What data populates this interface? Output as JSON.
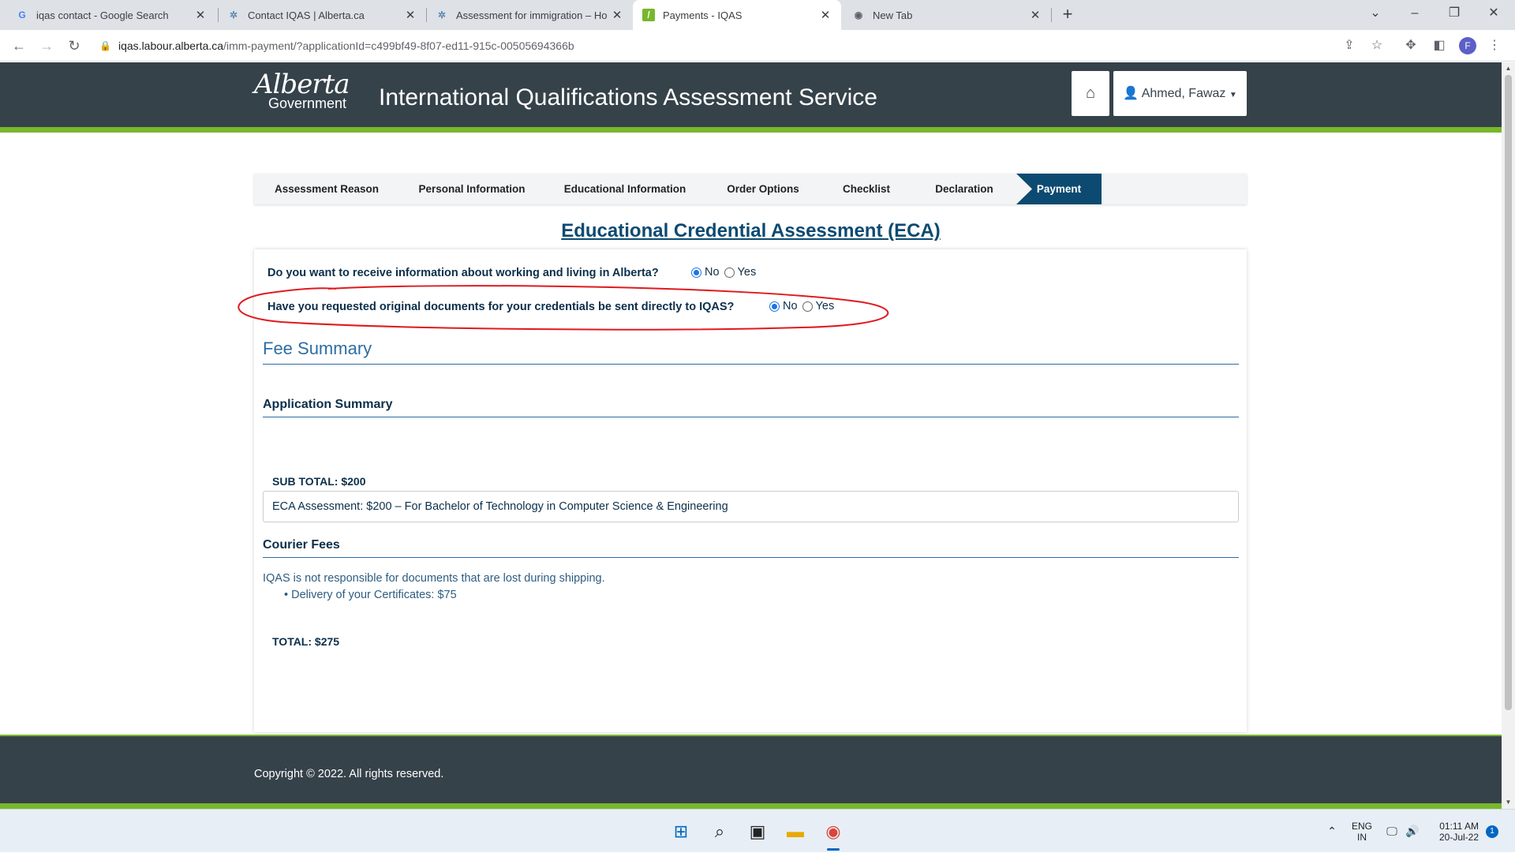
{
  "browser": {
    "tabs": [
      {
        "title": "iqas contact - Google Search",
        "icon": "google-icon"
      },
      {
        "title": "Contact IQAS | Alberta.ca",
        "icon": "alberta-icon"
      },
      {
        "title": "Assessment for immigration – Ho",
        "icon": "alberta-icon"
      },
      {
        "title": "Payments - IQAS",
        "icon": "iqas-icon"
      },
      {
        "title": "New Tab",
        "icon": "chrome-icon"
      }
    ],
    "url_host": "iqas.labour.alberta.ca",
    "url_path": "/imm-payment/?applicationId=c499bf49-8f07-ed11-915c-00505694366b",
    "profile_initial": "F"
  },
  "site": {
    "logo_script": "Alberta",
    "logo_sub": "Government",
    "title": "International Qualifications Assessment Service",
    "user_name": "Ahmed, Fawaz"
  },
  "steps": [
    {
      "label": "Assessment Reason"
    },
    {
      "label": "Personal Information"
    },
    {
      "label": "Educational Information"
    },
    {
      "label": "Order Options"
    },
    {
      "label": "Checklist"
    },
    {
      "label": "Declaration"
    },
    {
      "label": "Payment",
      "active": true
    }
  ],
  "page": {
    "heading": "Educational Credential Assessment (ECA)",
    "q1": "Do you want to receive information about working and living in Alberta?",
    "q2": "Have you requested original documents for your credentials be sent directly to IQAS?",
    "opt_no": "No",
    "opt_yes": "Yes",
    "q1_selected": "No",
    "q2_selected": "No",
    "annotation_color": "#e0191f",
    "fee_summary": "Fee Summary",
    "application_summary": "Application Summary",
    "summary_line": "ECA Assessment: $200 – For Bachelor of Technology in Computer Science & Engineering",
    "sub_total": "SUB TOTAL: $200",
    "courier_fees": "Courier Fees",
    "courier_note": "IQAS is not responsible for documents that are lost during shipping.",
    "courier_item": "Delivery of your Certificates: $75",
    "total": "TOTAL: $275",
    "copyright": "Copyright © 2022. All rights reserved."
  },
  "taskbar": {
    "lang": "ENG",
    "region": "IN",
    "time": "01:11 AM",
    "date": "20-Jul-22",
    "notifications": "1"
  },
  "colors": {
    "header_bg": "#36424a",
    "accent_green": "#77b82a",
    "step_active": "#0c4a71"
  }
}
